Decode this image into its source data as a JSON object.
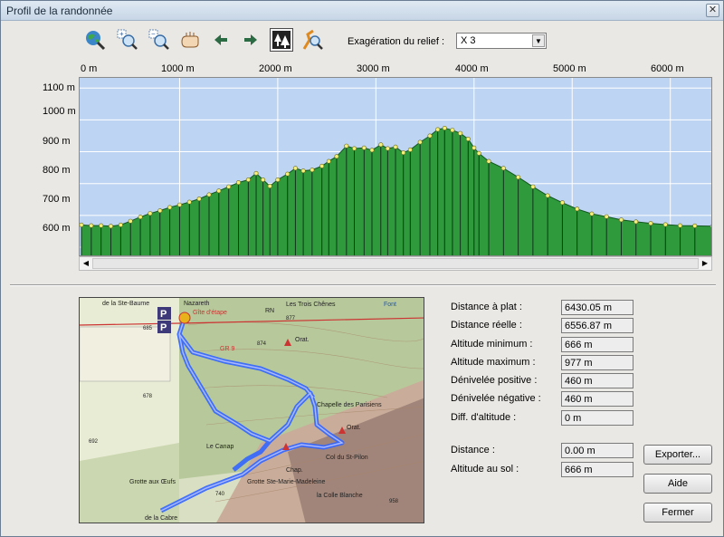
{
  "window": {
    "title": "Profil de la randonnée",
    "close_glyph": "✕"
  },
  "toolbar": {
    "icons": [
      "globe-zoom-icon",
      "zoom-in-icon",
      "zoom-out-icon",
      "hand-pan-icon",
      "arrow-left-icon",
      "arrow-right-icon",
      "forest-relief-icon",
      "route-zoom-icon"
    ],
    "exaggeration_label": "Exagération du relief :",
    "exaggeration_value": "X 3"
  },
  "chart_data": {
    "type": "area",
    "x_ticks": [
      "0 m",
      "1000 m",
      "2000 m",
      "3000 m",
      "4000 m",
      "5000 m",
      "6000 m"
    ],
    "y_ticks": [
      "1100 m",
      "1000 m",
      "900 m",
      "800 m",
      "700 m",
      "600 m"
    ],
    "xlim": [
      0,
      6430
    ],
    "ylim": [
      580,
      1115
    ],
    "grid": true,
    "colors": {
      "background": "#bdd4f2",
      "fill": "#2e9a3c",
      "grid": "#ffffff",
      "point": "#f5f07a"
    },
    "points": [
      [
        0,
        670
      ],
      [
        100,
        668
      ],
      [
        200,
        668
      ],
      [
        300,
        666
      ],
      [
        400,
        670
      ],
      [
        500,
        682
      ],
      [
        600,
        695
      ],
      [
        700,
        706
      ],
      [
        800,
        715
      ],
      [
        900,
        725
      ],
      [
        1000,
        733
      ],
      [
        1100,
        742
      ],
      [
        1200,
        752
      ],
      [
        1300,
        765
      ],
      [
        1400,
        777
      ],
      [
        1500,
        790
      ],
      [
        1600,
        803
      ],
      [
        1700,
        812
      ],
      [
        1780,
        832
      ],
      [
        1850,
        812
      ],
      [
        1920,
        792
      ],
      [
        2000,
        812
      ],
      [
        2100,
        830
      ],
      [
        2180,
        848
      ],
      [
        2260,
        840
      ],
      [
        2350,
        843
      ],
      [
        2450,
        855
      ],
      [
        2520,
        870
      ],
      [
        2600,
        885
      ],
      [
        2700,
        918
      ],
      [
        2780,
        910
      ],
      [
        2880,
        912
      ],
      [
        2960,
        905
      ],
      [
        3050,
        922
      ],
      [
        3120,
        910
      ],
      [
        3200,
        915
      ],
      [
        3280,
        897
      ],
      [
        3350,
        906
      ],
      [
        3450,
        930
      ],
      [
        3550,
        950
      ],
      [
        3630,
        970
      ],
      [
        3700,
        974
      ],
      [
        3780,
        968
      ],
      [
        3860,
        958
      ],
      [
        3940,
        940
      ],
      [
        4000,
        912
      ],
      [
        4050,
        895
      ],
      [
        4150,
        870
      ],
      [
        4300,
        848
      ],
      [
        4450,
        820
      ],
      [
        4600,
        790
      ],
      [
        4750,
        762
      ],
      [
        4900,
        740
      ],
      [
        5050,
        720
      ],
      [
        5200,
        705
      ],
      [
        5350,
        696
      ],
      [
        5500,
        686
      ],
      [
        5650,
        680
      ],
      [
        5800,
        675
      ],
      [
        5950,
        671
      ],
      [
        6100,
        668
      ],
      [
        6250,
        667
      ],
      [
        6430,
        666
      ]
    ]
  },
  "statistics": [
    {
      "label": "Distance à plat :",
      "value": "6430.05 m"
    },
    {
      "label": "Distance réelle :",
      "value": "6556.87 m"
    },
    {
      "label": "Altitude minimum :",
      "value": "666 m"
    },
    {
      "label": "Altitude maximum :",
      "value": "977 m"
    },
    {
      "label": "Dénivelée positive :",
      "value": "460 m"
    },
    {
      "label": "Dénivelée négative :",
      "value": "460 m"
    },
    {
      "label": "Diff. d'altitude :",
      "value": "0 m"
    }
  ],
  "cursor": [
    {
      "label": "Distance :",
      "value": "0.00 m"
    },
    {
      "label": "Altitude au sol :",
      "value": "666 m"
    }
  ],
  "buttons": {
    "export": "Exporter...",
    "help": "Aide",
    "close": "Fermer"
  },
  "map": {
    "labels": [
      "de la Ste-Baume",
      "Nazareth",
      "Gîte d'étape",
      "RN",
      "Les Trois Chênes",
      "Font",
      "Orat.",
      "GR 9",
      "Chapelle des Parisiens",
      "Le Canap",
      "Orat.",
      "Col du St-Pilon",
      "Grotte aux Œufs",
      "Grotte Ste-Marie-Madeleine",
      "Chap.",
      "la Colle Blanche",
      "de la Cabre",
      "685",
      "874",
      "692",
      "678",
      "958",
      "740",
      "877"
    ]
  }
}
